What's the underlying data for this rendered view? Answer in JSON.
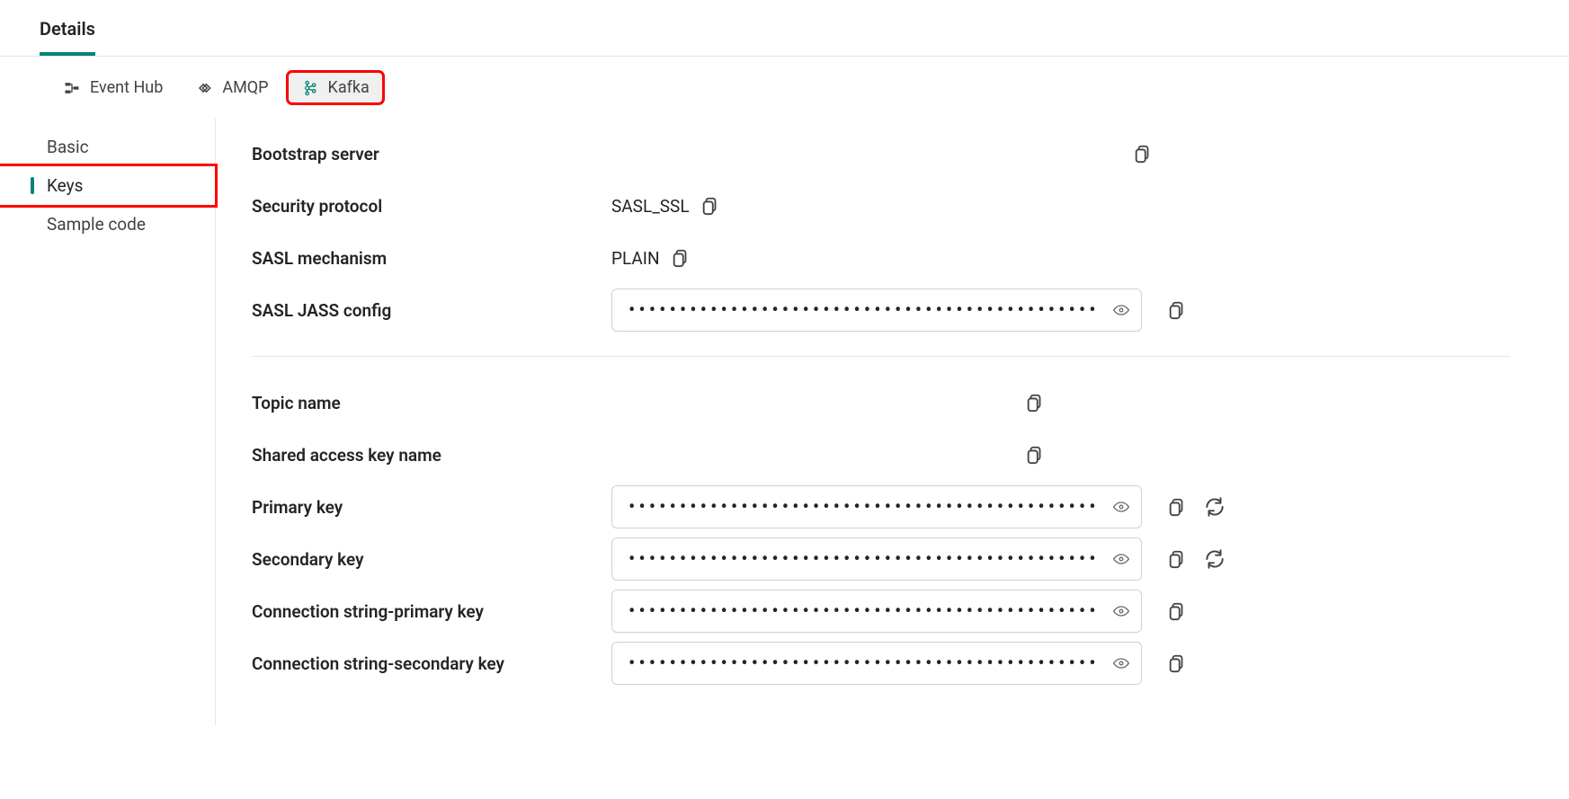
{
  "header": {
    "title_tab_label": "Details"
  },
  "protocol_tabs": {
    "event_hub": "Event Hub",
    "amqp": "AMQP",
    "kafka": "Kafka"
  },
  "side_nav": {
    "items": [
      {
        "label": "Basic"
      },
      {
        "label": "Keys"
      },
      {
        "label": "Sample code"
      }
    ],
    "active_index": 1
  },
  "fields": {
    "bootstrap_server": {
      "label": "Bootstrap server",
      "value": ""
    },
    "security_protocol": {
      "label": "Security protocol",
      "value": "SASL_SSL"
    },
    "sasl_mechanism": {
      "label": "SASL mechanism",
      "value": "PLAIN"
    },
    "sasl_jass_config": {
      "label": "SASL JASS config",
      "value": ""
    },
    "topic_name": {
      "label": "Topic name",
      "value": ""
    },
    "shared_access_key_name": {
      "label": "Shared access key name",
      "value": ""
    },
    "primary_key": {
      "label": "Primary key",
      "value": ""
    },
    "secondary_key": {
      "label": "Secondary key",
      "value": ""
    },
    "connection_string_primary": {
      "label": "Connection string-primary key",
      "value": ""
    },
    "connection_string_secondary": {
      "label": "Connection string-secondary key",
      "value": ""
    }
  },
  "masked_placeholder": "•••••••••••••••••••••••••••••••••••••••••••••••••••••",
  "colors": {
    "accent": "#008575",
    "highlight_box": "#ff0000"
  }
}
